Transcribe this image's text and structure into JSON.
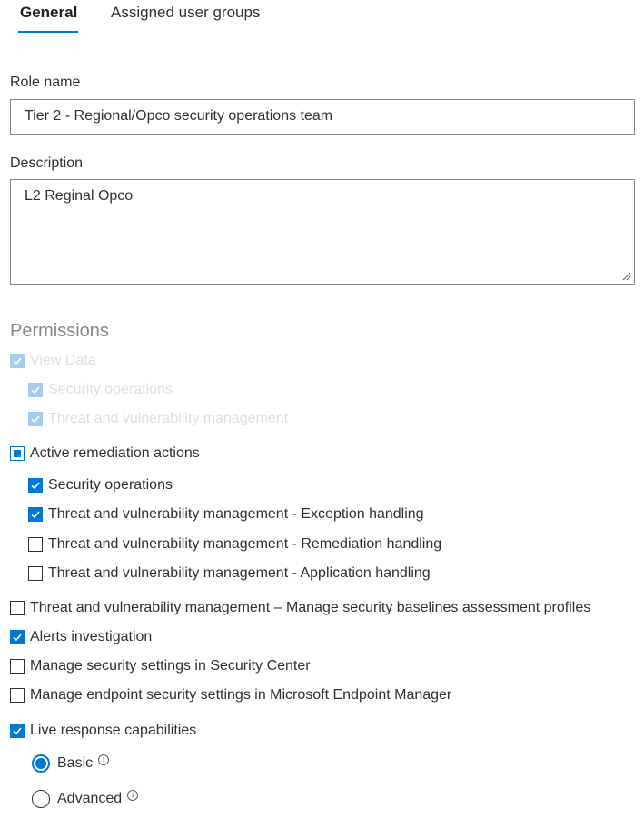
{
  "tabs": [
    {
      "label": "General",
      "active": true
    },
    {
      "label": "Assigned user groups",
      "active": false
    }
  ],
  "form": {
    "role_name_label": "Role name",
    "role_name_value": "Tier 2 - Regional/Opco security operations team",
    "description_label": "Description",
    "description_value": "L2 Reginal Opco"
  },
  "permissions": {
    "title": "Permissions",
    "view_data": {
      "label": "View Data",
      "checked": true,
      "disabled": true
    },
    "view_data_security_operations": {
      "label": "Security operations",
      "checked": true,
      "disabled": true
    },
    "view_data_tvm": {
      "label": "Threat and vulnerability management",
      "checked": true,
      "disabled": true
    },
    "active_remediation": {
      "label": "Active remediation actions",
      "state": "indeterminate"
    },
    "ar_security_operations": {
      "label": "Security operations",
      "checked": true
    },
    "ar_tvm_exception": {
      "label": "Threat and vulnerability management - Exception handling",
      "checked": true
    },
    "ar_tvm_remediation": {
      "label": "Threat and vulnerability management - Remediation handling",
      "checked": false
    },
    "ar_tvm_application": {
      "label": "Threat and vulnerability management - Application handling",
      "checked": false
    },
    "tvm_baselines": {
      "label": "Threat and vulnerability management – Manage security baselines assessment profiles",
      "checked": false
    },
    "alerts_investigation": {
      "label": "Alerts investigation",
      "checked": true
    },
    "security_settings": {
      "label": "Manage security settings in Security Center",
      "checked": false
    },
    "endpoint_settings": {
      "label": "Manage endpoint security settings in Microsoft Endpoint Manager",
      "checked": false
    },
    "live_response": {
      "label": "Live response capabilities",
      "checked": true
    },
    "live_response_options": [
      {
        "label": "Basic",
        "selected": true
      },
      {
        "label": "Advanced",
        "selected": false
      }
    ]
  },
  "colors": {
    "accent": "#0078d4",
    "disabled_text": "#e1dfdd"
  },
  "icons": {
    "check": "checkmark-icon",
    "info": "info-icon",
    "resize": "resize-grip-icon"
  }
}
